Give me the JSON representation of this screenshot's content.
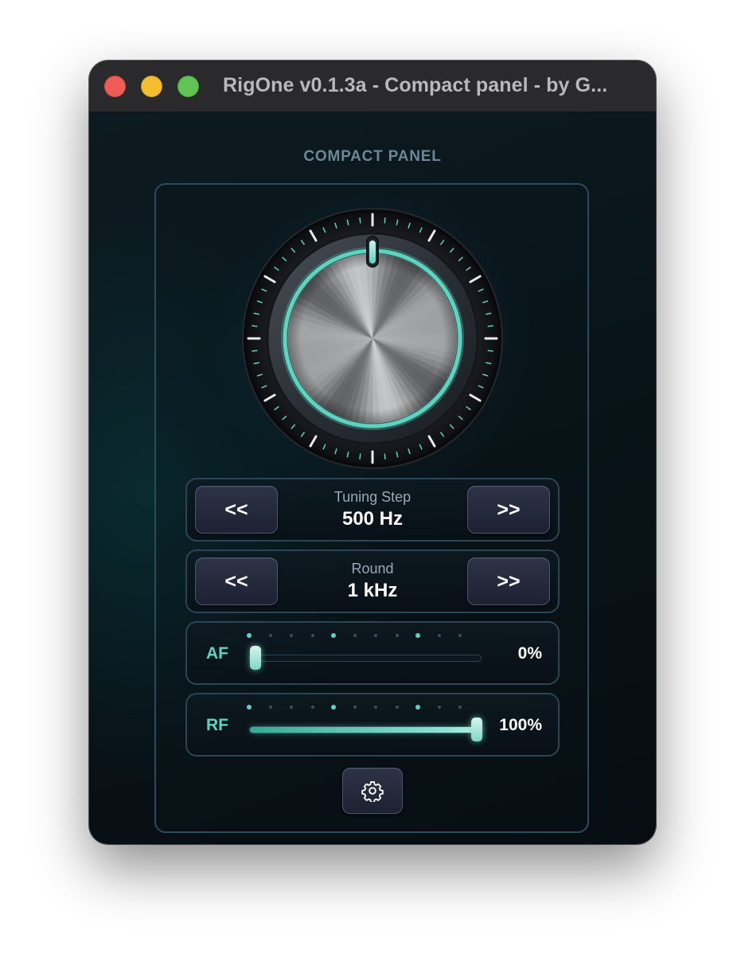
{
  "window": {
    "title": "RigOne v0.1.3a - Compact panel - by G..."
  },
  "panel": {
    "heading": "COMPACT PANEL"
  },
  "tuning_step": {
    "caption": "Tuning Step",
    "value": "500 Hz",
    "prev_label": "<<",
    "next_label": ">>"
  },
  "round": {
    "caption": "Round",
    "value": "1 kHz",
    "prev_label": "<<",
    "next_label": ">>"
  },
  "af": {
    "label": "AF",
    "value_text": "0%",
    "level": 0
  },
  "rf": {
    "label": "RF",
    "value_text": "100%",
    "level": 1.0
  },
  "settings": {
    "icon": "gear-icon"
  },
  "colors": {
    "accent": "#5fd3bf",
    "panel_border": "#2b4a5a",
    "background": "#081419"
  }
}
